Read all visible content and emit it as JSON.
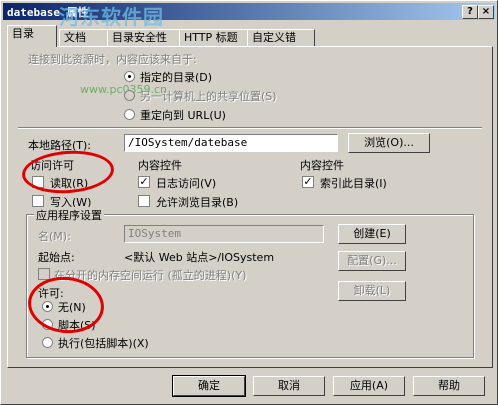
{
  "window": {
    "title": "datebase 属性",
    "help_btn": "?",
    "close_btn": "×",
    "watermark": "河东软件园",
    "watermark_sub": "www.pc0359.cn"
  },
  "tabs": [
    "目录",
    "文档",
    "目录安全性",
    "HTTP 标题",
    "自定义错"
  ],
  "content_source": {
    "heading": "连接到此资源时，内容应该来自于:",
    "options": [
      "指定的目录(D)",
      "另一计算机上的共享位置(S)",
      "重定向到 URL(U)"
    ]
  },
  "local_path": {
    "label": "本地路径(T):",
    "value": "/IOSystem/datebase",
    "browse": "浏览(O)..."
  },
  "access": {
    "heading": "访问许可",
    "read": "读取(R)",
    "write": "写入(W)"
  },
  "content_control": {
    "heading": "内容控件",
    "log_visits": "日志访问(V)",
    "dir_browse": "允许浏览目录(B)"
  },
  "content_control2": {
    "heading": "内容控件",
    "index": "索引此目录(I)"
  },
  "app_settings": {
    "heading": "应用程序设置",
    "name_label": "名(M):",
    "name_value": "IOSystem",
    "create": "创建(E)",
    "start_label": "起始点:",
    "start_value": "<默认 Web 站点>/IOSystem",
    "config": "配置(G)...",
    "isolated": "在分开的内存空间运行 (孤立的进程)(Y)",
    "unload": "卸载(L)",
    "permission_heading": "许可:",
    "permissions": [
      "无(N)",
      "脚本(S)",
      "执行(包括脚本)(X)"
    ]
  },
  "footer": {
    "ok": "确定",
    "cancel": "取消",
    "apply": "应用(A)",
    "help": "帮助"
  }
}
